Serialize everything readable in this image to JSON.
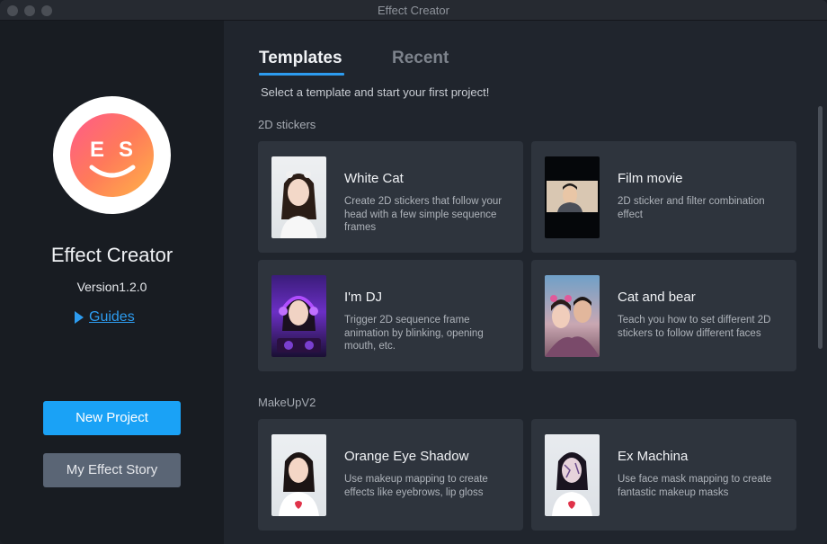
{
  "window": {
    "title": "Effect Creator"
  },
  "sidebar": {
    "app_name": "Effect Creator",
    "version": "Version1.2.0",
    "guides_label": "Guides",
    "new_project_label": "New Project",
    "my_effect_story_label": "My Effect Story"
  },
  "tabs": [
    {
      "label": "Templates",
      "active": true
    },
    {
      "label": "Recent",
      "active": false
    }
  ],
  "subtitle": "Select a template and start your first project!",
  "sections": [
    {
      "label": "2D stickers",
      "cards": [
        {
          "title": "White Cat",
          "description": "Create 2D stickers that follow your head with a few simple sequence frames",
          "thumb_icon": "girl-cat-ears-photo"
        },
        {
          "title": "Film movie",
          "description": "2D sticker and filter combination effect",
          "thumb_icon": "man-film-frame-photo"
        },
        {
          "title": "I'm DJ",
          "description": "Trigger 2D sequence frame animation by blinking, opening mouth, etc.",
          "thumb_icon": "girl-headphones-dj-photo"
        },
        {
          "title": "Cat and bear",
          "description": "Teach you how to set different 2D stickers to follow different faces",
          "thumb_icon": "couple-stickers-photo"
        }
      ]
    },
    {
      "label": "MakeUpV2",
      "cards": [
        {
          "title": "Orange Eye Shadow",
          "description": "Use makeup mapping to create effects like eyebrows, lip gloss",
          "thumb_icon": "girl-makeup-photo"
        },
        {
          "title": "Ex Machina",
          "description": "Use face mask mapping to create fantastic makeup masks",
          "thumb_icon": "girl-face-mask-photo"
        }
      ]
    }
  ],
  "colors": {
    "accent": "#2d9cf0",
    "primary_button": "#1aa2f6",
    "secondary_button": "#5a6575",
    "card_bg": "#2e343d",
    "sidebar_bg": "#181c22",
    "main_bg": "#20252d"
  }
}
